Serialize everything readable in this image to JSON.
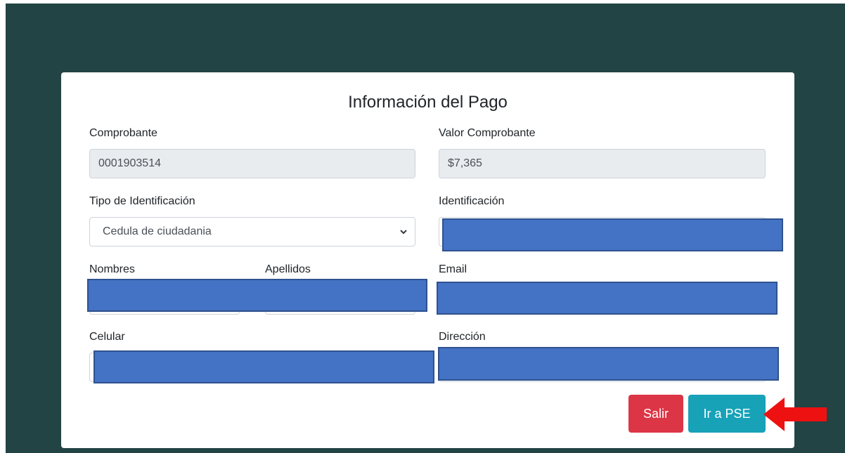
{
  "form": {
    "title": "Información del Pago",
    "comprobante": {
      "label": "Comprobante",
      "value": "0001903514"
    },
    "valor_comprobante": {
      "label": "Valor Comprobante",
      "value": "$7,365"
    },
    "tipo_identificacion": {
      "label": "Tipo de Identificación",
      "selected": "Cedula de ciudadania"
    },
    "identificacion": {
      "label": "Identificación"
    },
    "nombres": {
      "label": "Nombres"
    },
    "apellidos": {
      "label": "Apellidos"
    },
    "email": {
      "label": "Email"
    },
    "celular": {
      "label": "Celular"
    },
    "direccion": {
      "label": "Dirección"
    }
  },
  "buttons": {
    "salir": "Salir",
    "ir_pse": "Ir a PSE"
  },
  "colors": {
    "background": "#224444",
    "danger": "#dc3545",
    "info": "#17a2b8",
    "redaction": "#4472c4",
    "annotation_arrow": "#ee1111"
  },
  "icons": {
    "select_chevron": "chevron-down-icon",
    "annotation": "left-arrow-icon"
  }
}
